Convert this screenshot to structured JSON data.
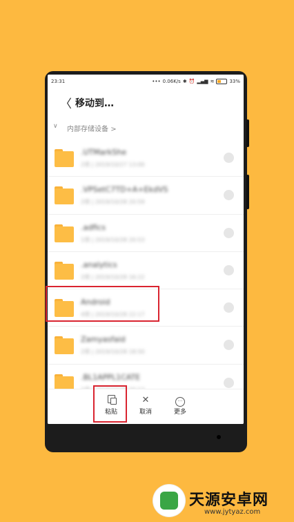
{
  "status_bar": {
    "time": "23:31",
    "speed": "0.06K/s",
    "battery": "33%"
  },
  "header": {
    "back_icon": "chevron-left-icon",
    "title": "移动到…"
  },
  "breadcrumb": {
    "path": "内部存储设备",
    "separator": ">"
  },
  "folders": [
    {
      "name": ".UTMarkShe",
      "meta": "2项 | 2019/10/27 13:00"
    },
    {
      "name": ".VPSetC7TD+A+EkdVS",
      "meta": "2项 | 2019/10/28 20:59"
    },
    {
      "name": ".adfics",
      "meta": "1项 | 2019/10/28 20:53"
    },
    {
      "name": ".analytics",
      "meta": "2项 | 2019/10/28 16:22"
    },
    {
      "name": "Android",
      "meta": "4项 | 2019/10/28 22:17"
    },
    {
      "name": "Zamyasfaid",
      "meta": "2项 | 2019/10/28 18:50"
    },
    {
      "name": ".BL1APPL1CATE",
      "meta": "1项 | 2019/10/28 20:13"
    }
  ],
  "toolbar": {
    "paste_label": "粘贴",
    "cancel_label": "取消",
    "more_label": "更多"
  },
  "watermark": {
    "title": "天源安卓网",
    "url": "www.jytyaz.com"
  },
  "colors": {
    "background": "#FDB940",
    "folder": "#FDBD45",
    "highlight": "#d9232f"
  }
}
